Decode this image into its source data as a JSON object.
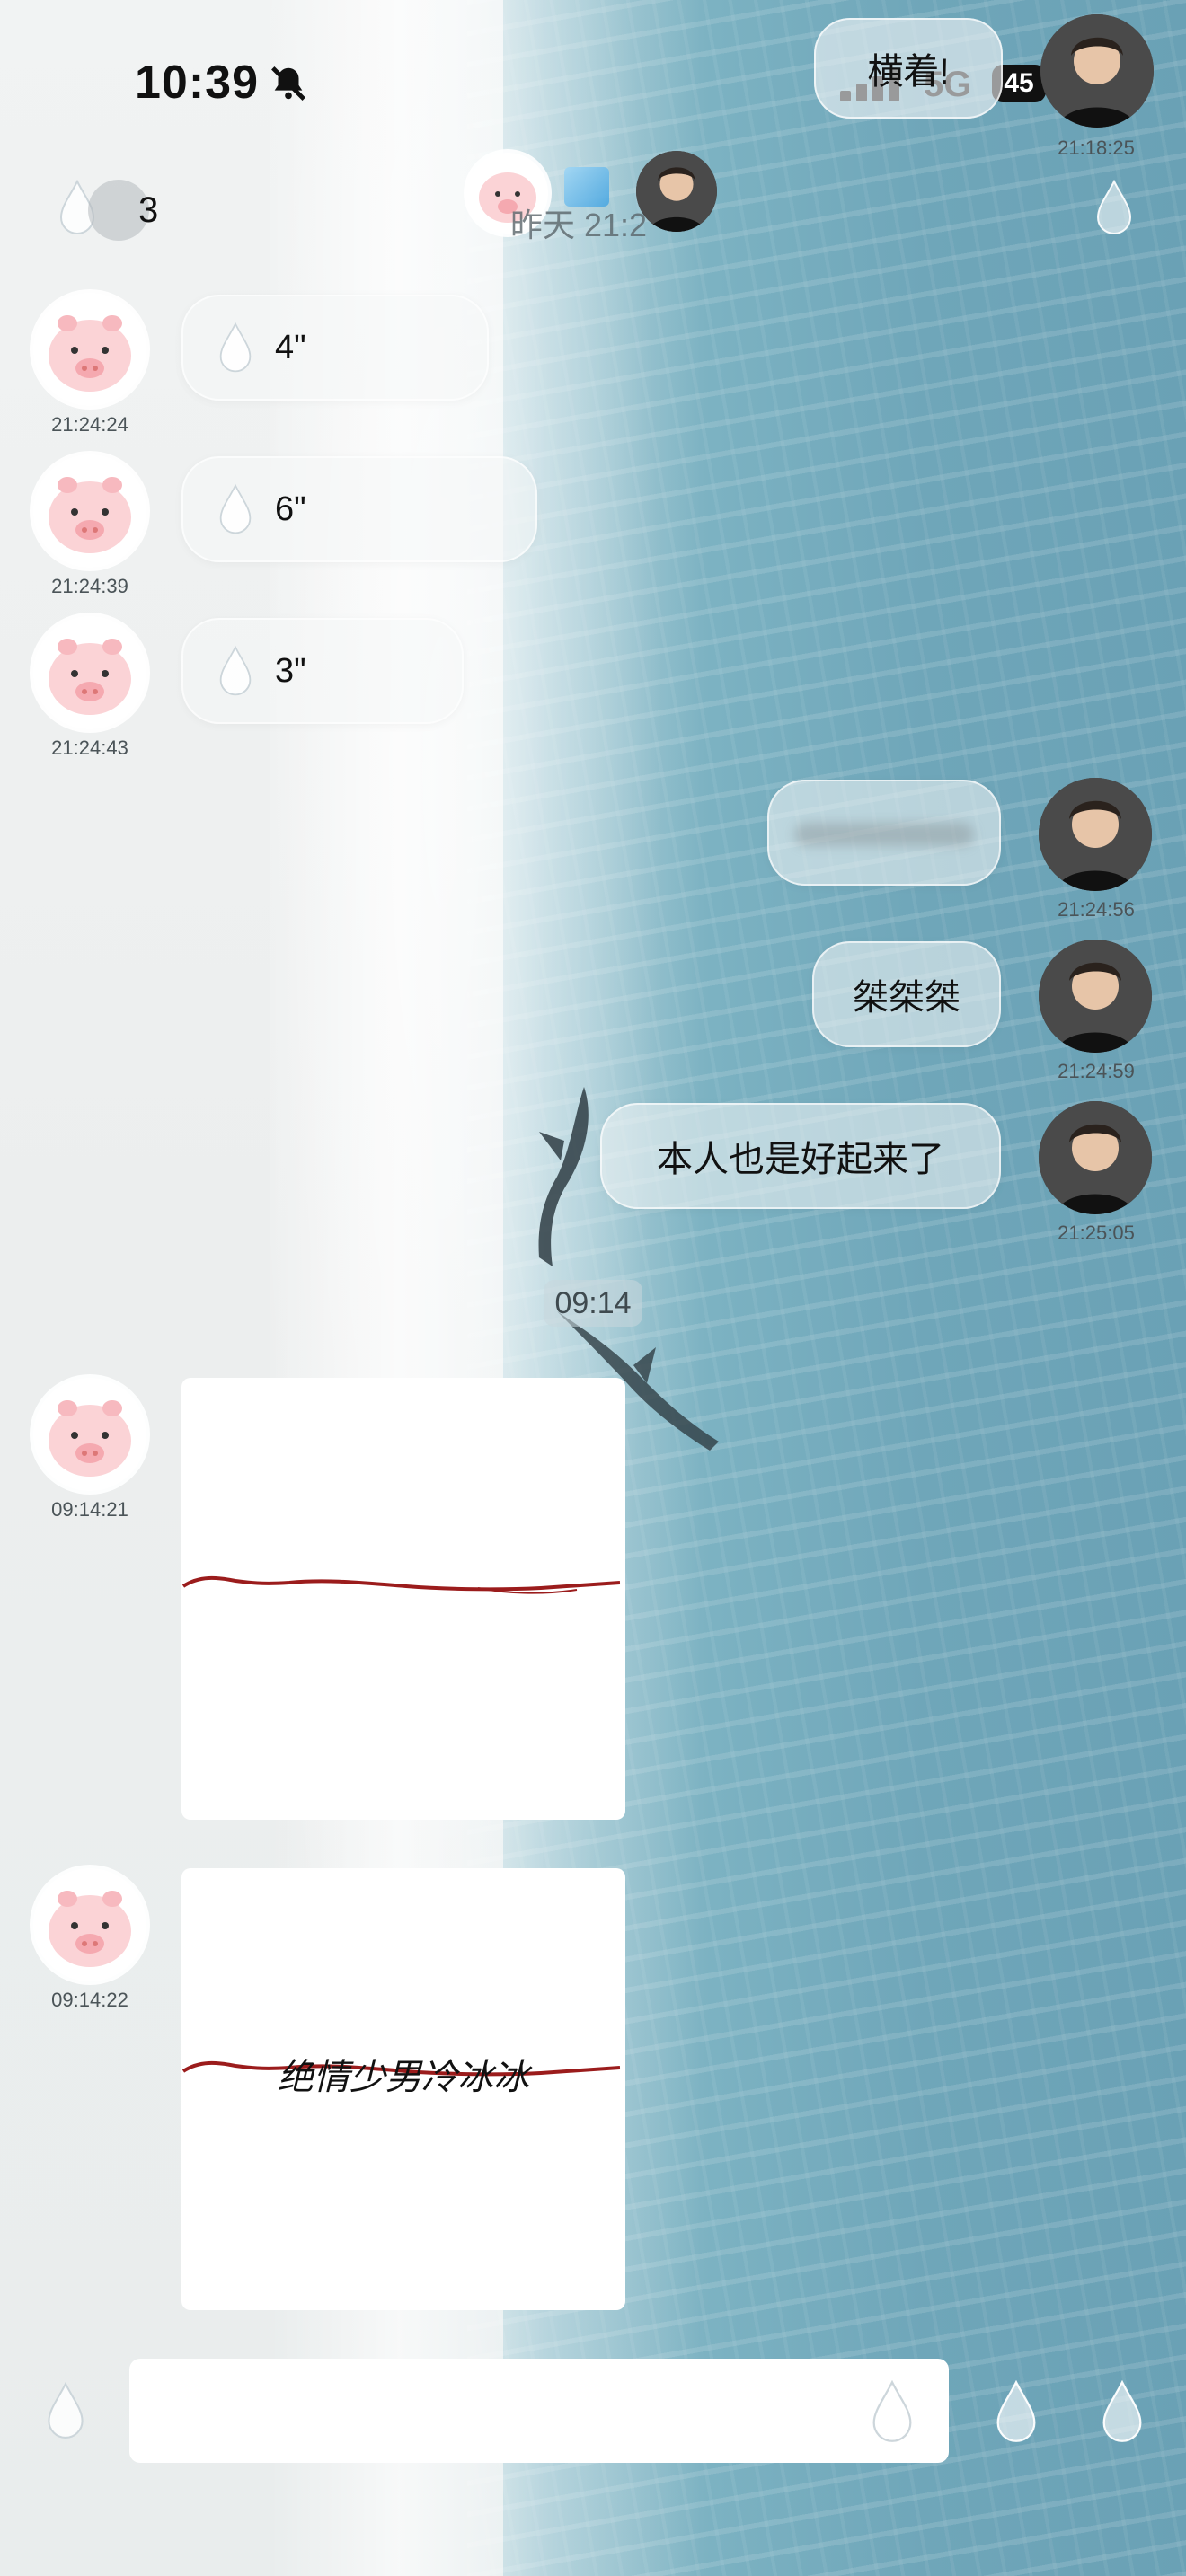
{
  "status_bar": {
    "time": "10:39",
    "network": "5G",
    "battery": "45"
  },
  "header": {
    "unread_count": "3",
    "name_tag": "横着!",
    "top_timestamp": "21:18:25",
    "notice_text": "昨天 21:2"
  },
  "messages": [
    {
      "side": "left",
      "type": "voice",
      "duration": "4\"",
      "time": "21:24:24"
    },
    {
      "side": "left",
      "type": "voice",
      "duration": "6\"",
      "time": "21:24:39"
    },
    {
      "side": "left",
      "type": "voice",
      "duration": "3\"",
      "time": "21:24:43"
    },
    {
      "side": "right",
      "type": "text",
      "text": "",
      "time": "21:24:56"
    },
    {
      "side": "right",
      "type": "text",
      "text": "桀桀桀",
      "time": "21:24:59"
    },
    {
      "side": "right",
      "type": "text",
      "text": "本人也是好起来了",
      "time": "21:25:05"
    }
  ],
  "divider_time": "09:14",
  "image_messages": [
    {
      "side": "left",
      "time": "09:14:21",
      "caption": ""
    },
    {
      "side": "left",
      "time": "09:14:22",
      "caption": "绝情少男冷冰冰"
    }
  ],
  "input": {
    "value": ""
  }
}
